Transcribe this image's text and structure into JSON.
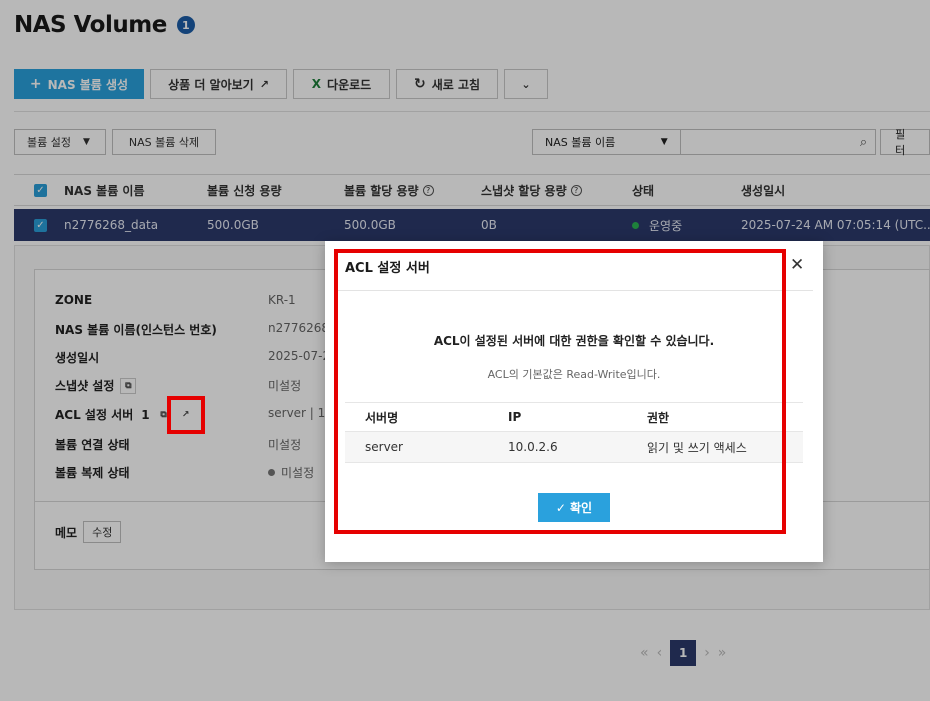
{
  "page": {
    "title": "NAS Volume",
    "count_badge": "1"
  },
  "toolbar": {
    "create_label": "NAS 볼륨 생성",
    "learn_more_label": "상품 더 알아보기",
    "download_label": "다운로드",
    "refresh_label": "새로 고침"
  },
  "filter": {
    "volume_settings_label": "볼륨 설정",
    "delete_label": "NAS 볼륨 삭제",
    "select_value": "NAS 볼륨 이름",
    "search_value": "",
    "filter_label": "필터"
  },
  "table": {
    "headers": [
      "NAS 볼륨 이름",
      "볼륨 신청 용량",
      "볼륨 할당 용량",
      "스냅샷 할당 용량",
      "상태",
      "생성일시"
    ],
    "rows": [
      {
        "name": "n2776268_data",
        "requested": "500.0GB",
        "allocated": "500.0GB",
        "snapshot": "0B",
        "status": "운영중",
        "created": "2025-07-24 AM 07:05:14 (UTC..."
      }
    ]
  },
  "detail": {
    "zone_label": "ZONE",
    "zone_value": "KR-1",
    "name_label": "NAS 볼륨 이름(인스턴스 번호)",
    "name_value": "n2776268_",
    "created_label": "생성일시",
    "created_value": "2025-07-24",
    "snapshot_label": "스냅샷 설정",
    "snapshot_value": "미설정",
    "acl_label": "ACL 설정 서버",
    "acl_count": "1",
    "acl_value": "server | 10.",
    "link_label": "볼륨 연결 상태",
    "link_value": "미설정",
    "replica_label": "볼륨 복제 상태",
    "replica_value": "미설정",
    "memo_label": "메모",
    "memo_edit_label": "수정"
  },
  "pagination": {
    "current": "1"
  },
  "modal": {
    "title": "ACL 설정 서버",
    "message": "ACL이 설정된 서버에 대한 권한을 확인할 수 있습니다.",
    "sub_message": "ACL의 기본값은 Read-Write입니다.",
    "headers": [
      "서버명",
      "IP",
      "권한"
    ],
    "rows": [
      {
        "server": "server",
        "ip": "10.0.2.6",
        "permission": "읽기 및 쓰기 액세스"
      }
    ],
    "confirm_label": "확인"
  },
  "colors": {
    "primary": "#2aa1dd",
    "selected_row": "#2b3a6b",
    "highlight": "#e60000",
    "status_running": "#2ab352"
  }
}
